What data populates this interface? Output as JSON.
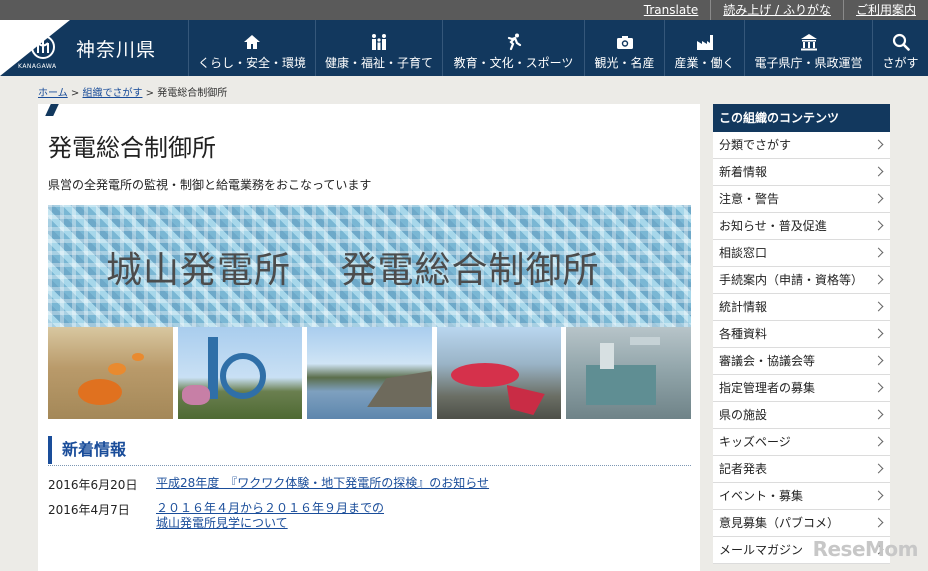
{
  "utility": {
    "links": [
      "Translate",
      "読み上げ / ふりがな",
      "ご利用案内"
    ]
  },
  "header": {
    "logo_text": "神奈川県",
    "logo_sub": "KANAGAWA",
    "nav": [
      {
        "label": "くらし・安全・環境",
        "icon": "home-icon"
      },
      {
        "label": "健康・福祉・子育て",
        "icon": "family-icon"
      },
      {
        "label": "教育・文化・スポーツ",
        "icon": "runner-icon"
      },
      {
        "label": "観光・名産",
        "icon": "camera-icon"
      },
      {
        "label": "産業・働く",
        "icon": "factory-icon"
      },
      {
        "label": "電子県庁・県政運営",
        "icon": "government-building-icon"
      },
      {
        "label": "さがす",
        "icon": "search-icon"
      }
    ]
  },
  "breadcrumb": {
    "home": "ホーム",
    "sep1": ">",
    "org": "組織でさがす",
    "sep2": ">",
    "current": "発電総合制御所"
  },
  "main": {
    "title": "発電総合制御所",
    "lead": "県営の全発電所の監視・制御と給電業務をおこなっています",
    "banner_text": "城山発電所　 発電総合制御所",
    "news_title": "新着情報",
    "news": [
      {
        "date": "2016年6月20日",
        "text": "平成28年度　『ワクワク体験・地下発電所の探検』のお知らせ"
      },
      {
        "date": "2016年4月7日",
        "text": "２０１６年４月から２０１６年９月までの",
        "text2": "城山発電所見学について"
      }
    ]
  },
  "sidebar": {
    "title": "この組織のコンテンツ",
    "items": [
      "分類でさがす",
      "新着情報",
      "注意・警告",
      "お知らせ・普及促進",
      "相談窓口",
      "手続案内（申請・資格等）",
      "統計情報",
      "各種資料",
      "審議会・協議会等",
      "指定管理者の募集",
      "県の施設",
      "キッズページ",
      "記者発表",
      "イベント・募集",
      "意見募集（パブコメ）",
      "メールマガジン"
    ]
  },
  "watermark": "ReseMom",
  "colors": {
    "nav_bg": "#12385e",
    "link": "#1a4d9a",
    "util_bg": "#5a5a5a"
  }
}
